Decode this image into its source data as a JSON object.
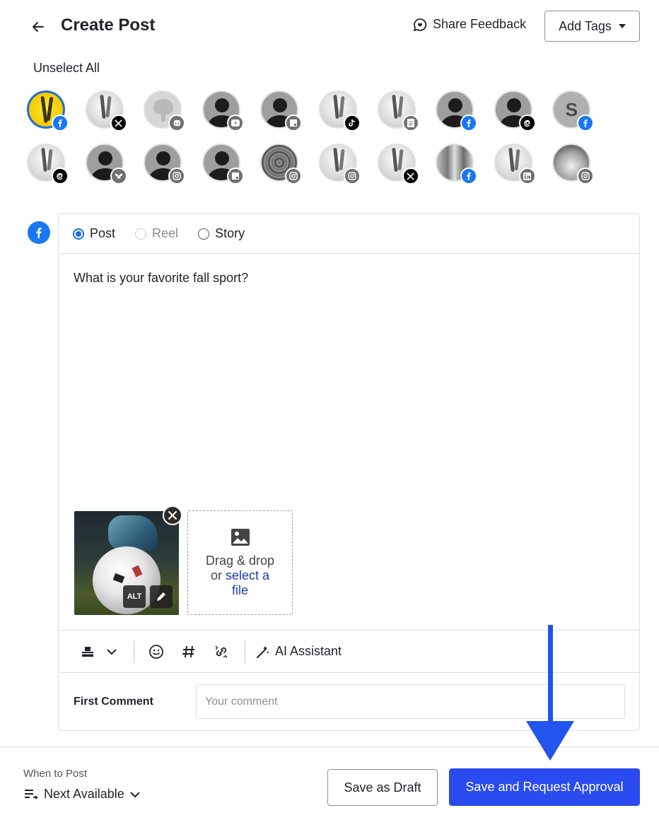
{
  "header": {
    "title": "Create Post",
    "share_feedback": "Share Feedback",
    "add_tags": "Add Tags"
  },
  "profiles": {
    "unselect_all": "Unselect All",
    "items": [
      {
        "style": "yellow",
        "network": "facebook",
        "selected": true
      },
      {
        "style": "photo",
        "network": "x",
        "selected": false
      },
      {
        "style": "elephant",
        "network": "mastodon",
        "selected": false
      },
      {
        "style": "person",
        "network": "youtube",
        "selected": false
      },
      {
        "style": "person",
        "network": "google-business",
        "selected": false
      },
      {
        "style": "photo",
        "network": "tiktok",
        "selected": false
      },
      {
        "style": "photo",
        "network": "blog",
        "selected": false
      },
      {
        "style": "person",
        "network": "facebook",
        "selected": false
      },
      {
        "style": "person",
        "network": "threads",
        "selected": false
      },
      {
        "style": "letter",
        "letter": "S",
        "network": "facebook",
        "selected": false
      },
      {
        "style": "photo",
        "network": "threads",
        "selected": false
      },
      {
        "style": "person",
        "network": "bluesky",
        "selected": false
      },
      {
        "style": "person",
        "network": "instagram",
        "selected": false
      },
      {
        "style": "person",
        "network": "google-business",
        "selected": false
      },
      {
        "style": "mandala",
        "network": "instagram",
        "selected": false
      },
      {
        "style": "photo",
        "network": "instagram",
        "selected": false
      },
      {
        "style": "photo",
        "network": "x",
        "selected": false
      },
      {
        "style": "crowd",
        "network": "facebook",
        "selected": false
      },
      {
        "style": "photo",
        "network": "linkedin",
        "selected": false
      },
      {
        "style": "shoe",
        "network": "instagram",
        "selected": false
      }
    ]
  },
  "composer": {
    "network_icon": "facebook-icon",
    "post_types": [
      {
        "label": "Post",
        "checked": true,
        "disabled": false
      },
      {
        "label": "Reel",
        "checked": false,
        "disabled": true
      },
      {
        "label": "Story",
        "checked": false,
        "disabled": false
      }
    ],
    "text": "What is your favorite fall sport?",
    "media": {
      "alt_label": "ALT"
    },
    "dropzone": {
      "line1": "Drag & drop",
      "line2_prefix": "or ",
      "link": "select a",
      "link2": "file"
    },
    "toolbar": {
      "ai_assistant": "AI Assistant"
    },
    "first_comment": {
      "label": "First Comment",
      "placeholder": "Your comment"
    }
  },
  "footer": {
    "when_label": "When to Post",
    "when_value": "Next Available",
    "save_draft": "Save as Draft",
    "save_request": "Save and Request Approval"
  },
  "colors": {
    "primary": "#2a4bf0",
    "facebook": "#1877f2",
    "selected_ring": "#1b6fd8",
    "annotation_arrow": "#2255ee"
  }
}
